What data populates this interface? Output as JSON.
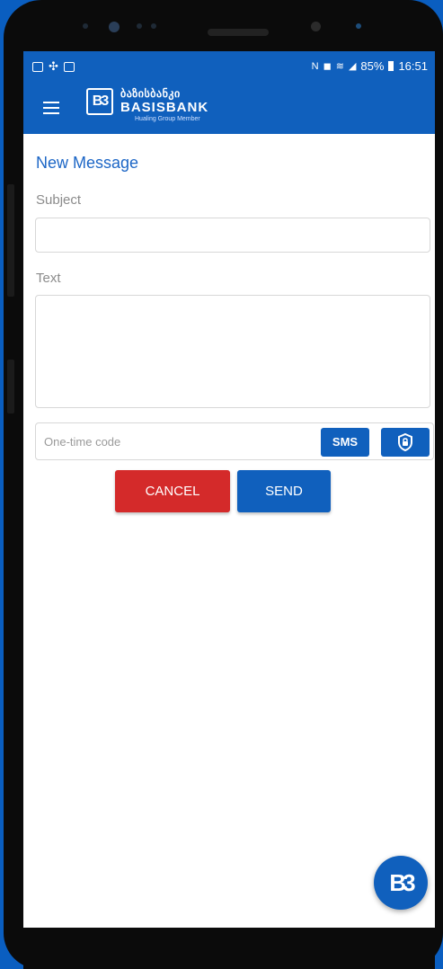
{
  "status_bar": {
    "battery": "85%",
    "time": "16:51"
  },
  "app_bar": {
    "logo_mark": "B3",
    "brand_geo": "ბაზისბანკი",
    "brand_name": "BASISBANK",
    "brand_sub": "Hualing Group Member"
  },
  "form": {
    "title": "New Message",
    "subject_label": "Subject",
    "subject_value": "",
    "text_label": "Text",
    "text_value": "",
    "otp_placeholder": "One-time code",
    "sms_label": "SMS",
    "shield_icon": "shield-lock-icon"
  },
  "actions": {
    "cancel_label": "CANCEL",
    "send_label": "SEND"
  },
  "fab": {
    "label": "B3"
  },
  "colors": {
    "primary": "#1060bd",
    "danger": "#d42a2a",
    "background": "#0a5ec0"
  }
}
